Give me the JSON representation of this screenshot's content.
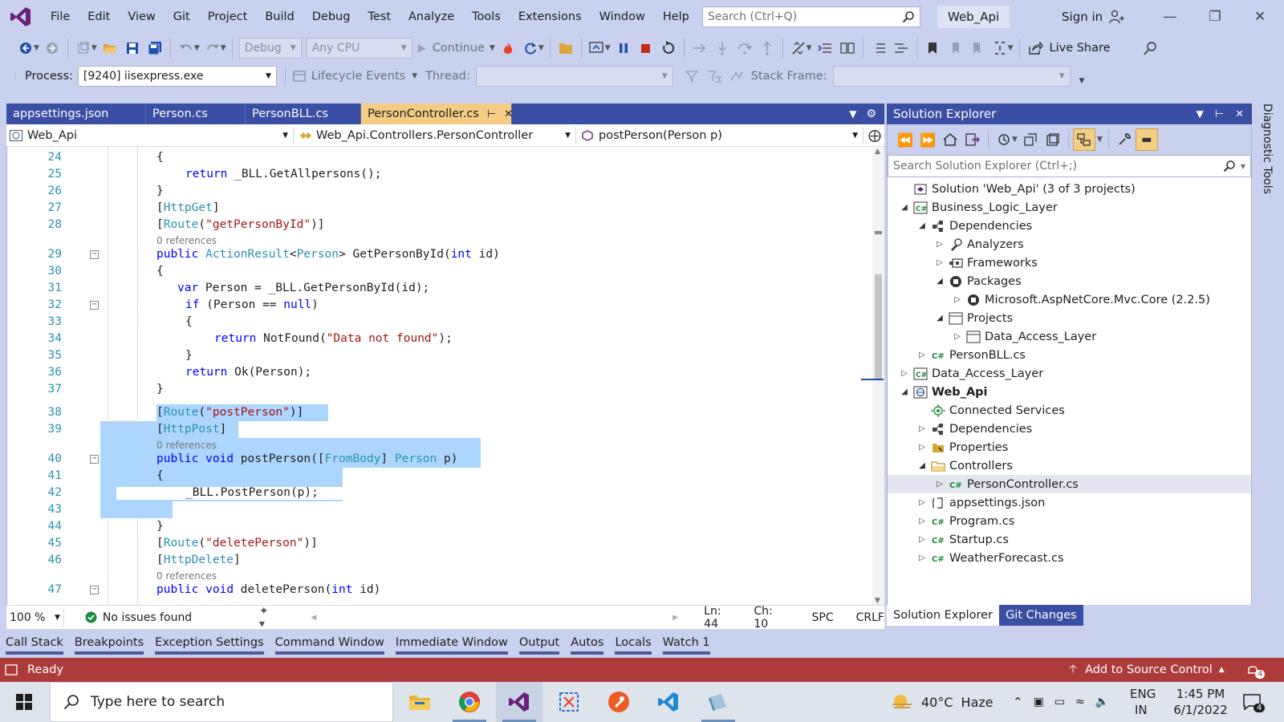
{
  "menubar": {
    "items": [
      "File",
      "Edit",
      "View",
      "Git",
      "Project",
      "Build",
      "Debug",
      "Test",
      "Analyze",
      "Tools",
      "Extensions",
      "Window",
      "Help"
    ],
    "search_placeholder": "Search (Ctrl+Q)",
    "solution_name": "Web_Api",
    "sign_in": "Sign in"
  },
  "toolbar": {
    "config": "Debug",
    "platform": "Any CPU",
    "continue_label": "Continue",
    "live_share": "Live Share",
    "process_label": "Process:",
    "process_value": "[9240] iisexpress.exe",
    "lifecycle_events": "Lifecycle Events",
    "thread_label": "Thread:",
    "stack_frame_label": "Stack Frame:"
  },
  "doc_tabs": [
    {
      "label": "appsettings.json",
      "active": false
    },
    {
      "label": "Person.cs",
      "active": false
    },
    {
      "label": "PersonBLL.cs",
      "active": false
    },
    {
      "label": "PersonController.cs",
      "active": true
    }
  ],
  "nav_bar": {
    "project": "Web_Api",
    "type": "Web_Api.Controllers.PersonController",
    "member": "postPerson(Person p)"
  },
  "code": {
    "references_label": "0 references",
    "lines": [
      {
        "n": "24",
        "text": "{"
      },
      {
        "n": "25",
        "text": "return _BLL.GetAllpersons();"
      },
      {
        "n": "26",
        "text": "}"
      },
      {
        "n": "27",
        "text": "[HttpGet]"
      },
      {
        "n": "28",
        "text": "[Route(\"getPersonById\")]"
      },
      {
        "n": "29",
        "text": "public ActionResult<Person> GetPersonById(int id)"
      },
      {
        "n": "30",
        "text": "{"
      },
      {
        "n": "31",
        "text": "var Person = _BLL.GetPersonById(id);"
      },
      {
        "n": "32",
        "text": "if (Person == null)"
      },
      {
        "n": "33",
        "text": "{"
      },
      {
        "n": "34",
        "text": "return NotFound(\"Data not found\");"
      },
      {
        "n": "35",
        "text": "}"
      },
      {
        "n": "36",
        "text": "return Ok(Person);"
      },
      {
        "n": "37",
        "text": "}"
      },
      {
        "n": "38",
        "text": "[Route(\"postPerson\")]"
      },
      {
        "n": "39",
        "text": "[HttpPost]"
      },
      {
        "n": "40",
        "text": "public void postPerson([FromBody] Person p)"
      },
      {
        "n": "41",
        "text": "{"
      },
      {
        "n": "42",
        "text": "_BLL.PostPerson(p);"
      },
      {
        "n": "43",
        "text": ""
      },
      {
        "n": "44",
        "text": "}"
      },
      {
        "n": "45",
        "text": "[Route(\"deletePerson\")]"
      },
      {
        "n": "46",
        "text": "[HttpDelete]"
      },
      {
        "n": "47",
        "text": "public void deletePerson(int id)"
      }
    ]
  },
  "editor_status": {
    "zoom": "100 %",
    "issues": "No issues found",
    "line": "Ln: 44",
    "col": "Ch: 10",
    "spc": "SPC",
    "crlf": "CRLF"
  },
  "solution_explorer": {
    "title": "Solution Explorer",
    "search_placeholder": "Search Solution Explorer (Ctrl+;)",
    "tree": [
      {
        "label": "Solution 'Web_Api' (3 of 3 projects)",
        "depth": 0,
        "tw": "",
        "icon": "solution",
        "bold": false,
        "selected": false
      },
      {
        "label": "Business_Logic_Layer",
        "depth": 0,
        "tw": "open",
        "icon": "cs-project",
        "bold": false,
        "selected": false
      },
      {
        "label": "Dependencies",
        "depth": 1,
        "tw": "open",
        "icon": "dependencies",
        "bold": false,
        "selected": false
      },
      {
        "label": "Analyzers",
        "depth": 2,
        "tw": "closed",
        "icon": "analyzers",
        "bold": false,
        "selected": false
      },
      {
        "label": "Frameworks",
        "depth": 2,
        "tw": "closed",
        "icon": "frameworks",
        "bold": false,
        "selected": false
      },
      {
        "label": "Packages",
        "depth": 2,
        "tw": "open",
        "icon": "package",
        "bold": false,
        "selected": false
      },
      {
        "label": "Microsoft.AspNetCore.Mvc.Core (2.2.5)",
        "depth": 3,
        "tw": "closed",
        "icon": "package",
        "bold": false,
        "selected": false
      },
      {
        "label": "Projects",
        "depth": 2,
        "tw": "open",
        "icon": "projects",
        "bold": false,
        "selected": false
      },
      {
        "label": "Data_Access_Layer",
        "depth": 3,
        "tw": "closed",
        "icon": "projects",
        "bold": false,
        "selected": false
      },
      {
        "label": "PersonBLL.cs",
        "depth": 1,
        "tw": "closed",
        "icon": "cs-file",
        "bold": false,
        "selected": false
      },
      {
        "label": "Data_Access_Layer",
        "depth": 0,
        "tw": "closed",
        "icon": "cs-project",
        "bold": false,
        "selected": false
      },
      {
        "label": "Web_Api",
        "depth": 0,
        "tw": "open",
        "icon": "web-project",
        "bold": true,
        "selected": false
      },
      {
        "label": "Connected Services",
        "depth": 1,
        "tw": "",
        "icon": "connected-services",
        "bold": false,
        "selected": false
      },
      {
        "label": "Dependencies",
        "depth": 1,
        "tw": "closed",
        "icon": "dependencies",
        "bold": false,
        "selected": false
      },
      {
        "label": "Properties",
        "depth": 1,
        "tw": "closed",
        "icon": "properties",
        "bold": false,
        "selected": false
      },
      {
        "label": "Controllers",
        "depth": 1,
        "tw": "open",
        "icon": "folder",
        "bold": false,
        "selected": false
      },
      {
        "label": "PersonController.cs",
        "depth": 2,
        "tw": "closed",
        "icon": "cs-file",
        "bold": false,
        "selected": true
      },
      {
        "label": "appsettings.json",
        "depth": 1,
        "tw": "closed",
        "icon": "json-file",
        "bold": false,
        "selected": false
      },
      {
        "label": "Program.cs",
        "depth": 1,
        "tw": "closed",
        "icon": "cs-file",
        "bold": false,
        "selected": false
      },
      {
        "label": "Startup.cs",
        "depth": 1,
        "tw": "closed",
        "icon": "cs-file",
        "bold": false,
        "selected": false
      },
      {
        "label": "WeatherForecast.cs",
        "depth": 1,
        "tw": "closed",
        "icon": "cs-file",
        "bold": false,
        "selected": false
      }
    ],
    "tabs": [
      "Solution Explorer",
      "Git Changes"
    ]
  },
  "diagnostic_tools": "Diagnostic Tools",
  "tool_windows": [
    "Call Stack",
    "Breakpoints",
    "Exception Settings",
    "Command Window",
    "Immediate Window",
    "Output",
    "Autos",
    "Locals",
    "Watch 1"
  ],
  "status_bar": {
    "state": "Ready",
    "source_control": "Add to Source Control",
    "notifications": "4"
  },
  "taskbar": {
    "search_placeholder": "Type here to search",
    "weather_temp": "40°C",
    "weather_desc": "Haze",
    "lang_top": "ENG",
    "lang_bottom": "IN",
    "time": "1:45 PM",
    "date": "6/1/2022",
    "notif_count": "4"
  },
  "colors": {
    "chrome_bg": "#c9d1ef",
    "tab_blue": "#3a4ea3",
    "active_tab": "#f5cc84",
    "selection": "#add6ff",
    "status_bar": "#ad3b3b",
    "keyword": "#0000ff",
    "type": "#2b91af",
    "string": "#a31515"
  }
}
